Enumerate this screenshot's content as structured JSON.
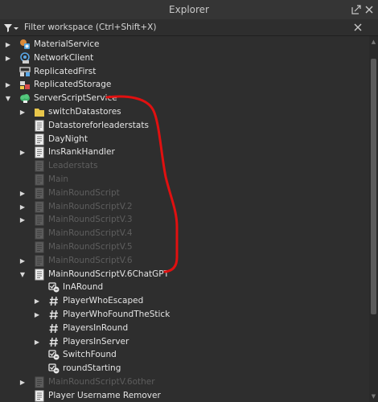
{
  "window": {
    "title": "Explorer",
    "popout_icon": "popout-icon",
    "close_icon": "close-icon"
  },
  "filter": {
    "placeholder": "Filter workspace (Ctrl+Shift+X)",
    "icon": "filter-funnel-icon",
    "clear_icon": "close-icon"
  },
  "colors": {
    "background": "#2e2e2e",
    "text": "#e4e4e4",
    "disabled_text": "#5e5e5e",
    "annotation_red": "#e01010",
    "folder_yellow": "#e8c64a"
  },
  "tree": [
    {
      "label": "MaterialService",
      "icon": "material-service-icon",
      "depth": 0,
      "arrow": "collapsed",
      "disabled": false
    },
    {
      "label": "NetworkClient",
      "icon": "network-client-icon",
      "depth": 0,
      "arrow": "collapsed",
      "disabled": false
    },
    {
      "label": "ReplicatedFirst",
      "icon": "replicated-first-icon",
      "depth": 0,
      "arrow": "none",
      "disabled": false
    },
    {
      "label": "ReplicatedStorage",
      "icon": "replicated-storage-icon",
      "depth": 0,
      "arrow": "collapsed",
      "disabled": false
    },
    {
      "label": "ServerScriptService",
      "icon": "server-script-service-icon",
      "depth": 0,
      "arrow": "expanded",
      "disabled": false
    },
    {
      "label": "switchDatastores",
      "icon": "folder-icon",
      "depth": 1,
      "arrow": "collapsed",
      "disabled": false
    },
    {
      "label": "Datastoreforleaderstats",
      "icon": "script-icon",
      "depth": 1,
      "arrow": "none",
      "disabled": false
    },
    {
      "label": "DayNight",
      "icon": "script-icon",
      "depth": 1,
      "arrow": "none",
      "disabled": false
    },
    {
      "label": "InsRankHandler",
      "icon": "script-icon",
      "depth": 1,
      "arrow": "collapsed",
      "disabled": false
    },
    {
      "label": "Leaderstats",
      "icon": "script-icon",
      "depth": 1,
      "arrow": "none",
      "disabled": true
    },
    {
      "label": "Main",
      "icon": "script-icon",
      "depth": 1,
      "arrow": "none",
      "disabled": true
    },
    {
      "label": "MainRoundScript",
      "icon": "script-icon",
      "depth": 1,
      "arrow": "collapsed",
      "disabled": true
    },
    {
      "label": "MainRoundScriptV.2",
      "icon": "script-icon",
      "depth": 1,
      "arrow": "collapsed",
      "disabled": true
    },
    {
      "label": "MainRoundScriptV.3",
      "icon": "script-icon",
      "depth": 1,
      "arrow": "collapsed",
      "disabled": true
    },
    {
      "label": "MainRoundScriptV.4",
      "icon": "script-icon",
      "depth": 1,
      "arrow": "none",
      "disabled": true
    },
    {
      "label": "MainRoundScriptV.5",
      "icon": "script-icon",
      "depth": 1,
      "arrow": "none",
      "disabled": true
    },
    {
      "label": "MainRoundScriptV.6",
      "icon": "script-icon",
      "depth": 1,
      "arrow": "collapsed",
      "disabled": true
    },
    {
      "label": "MainRoundScriptV.6ChatGPT",
      "icon": "script-icon",
      "depth": 1,
      "arrow": "expanded",
      "disabled": false
    },
    {
      "label": "InARound",
      "icon": "bool-value-icon",
      "depth": 2,
      "arrow": "none",
      "disabled": false
    },
    {
      "label": "PlayerWhoEscaped",
      "icon": "number-value-icon",
      "depth": 2,
      "arrow": "collapsed",
      "disabled": false
    },
    {
      "label": "PlayerWhoFoundTheStick",
      "icon": "number-value-icon",
      "depth": 2,
      "arrow": "collapsed",
      "disabled": false
    },
    {
      "label": "PlayersInRound",
      "icon": "number-value-icon",
      "depth": 2,
      "arrow": "none",
      "disabled": false
    },
    {
      "label": "PlayersInServer",
      "icon": "number-value-icon",
      "depth": 2,
      "arrow": "collapsed",
      "disabled": false
    },
    {
      "label": "SwitchFound",
      "icon": "bool-value-icon",
      "depth": 2,
      "arrow": "none",
      "disabled": false
    },
    {
      "label": "roundStarting",
      "icon": "bool-value-icon",
      "depth": 2,
      "arrow": "none",
      "disabled": false
    },
    {
      "label": "MainRoundScriptV.6other",
      "icon": "script-icon",
      "depth": 1,
      "arrow": "collapsed",
      "disabled": true
    },
    {
      "label": "Player Username Remover",
      "icon": "script-icon",
      "depth": 1,
      "arrow": "none",
      "disabled": false
    }
  ]
}
